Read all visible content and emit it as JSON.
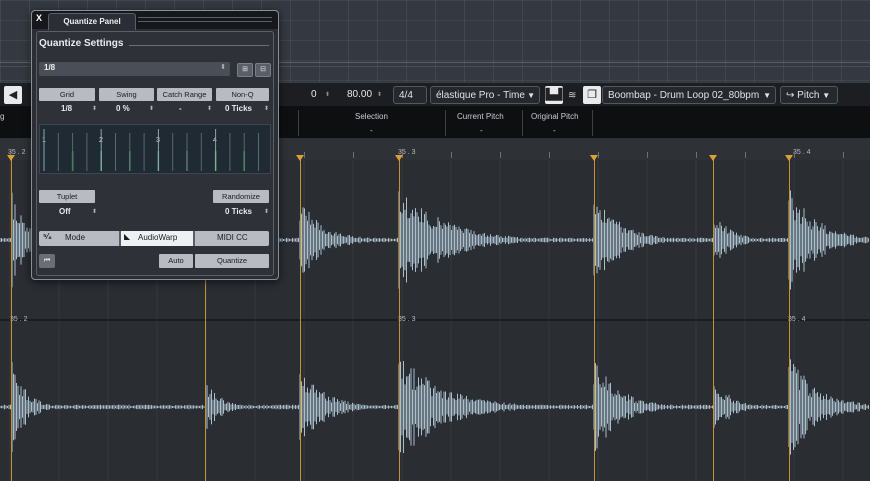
{
  "transport": {
    "value1": "0",
    "tempo": "80.00",
    "signature": "4/4",
    "algorithm": "élastique Pro - Time",
    "event_name": "Boombap - Drum Loop 02_80bpm",
    "pitch_label": "Pitch"
  },
  "infoline": {
    "left_fragment": "g",
    "selection_label": "Selection",
    "selection_value": "-",
    "current_pitch_label": "Current Pitch",
    "current_pitch_value": "-",
    "original_pitch_label": "Original Pitch",
    "original_pitch_value": "-"
  },
  "ruler": {
    "labels": [
      "35 . 2",
      "35 . 3",
      "35 . 4"
    ],
    "lane2_labels": [
      "35 . 2",
      "35 . 3",
      "35 . 4"
    ]
  },
  "quantize_panel": {
    "close_label": "X",
    "tab_label": "Quantize Panel",
    "section_title": "Quantize Settings",
    "preset": "1/8",
    "grid_label": "Grid",
    "grid_value": "1/8",
    "swing_label": "Swing",
    "swing_value": "0 %",
    "catch_label": "Catch Range",
    "catch_value": "-",
    "nonq_label": "Non-Q",
    "nonq_value": "0 Ticks",
    "beat_numbers": [
      "1",
      "2",
      "3",
      "4"
    ],
    "tuplet_label": "Tuplet",
    "tuplet_value": "Off",
    "randomize_label": "Randomize",
    "randomize_value": "0 Ticks",
    "mode_label": "Mode",
    "audiowarp_label": "AudioWarp",
    "midicc_label": "MIDI CC",
    "auto_label": "Auto",
    "quantize_label": "Quantize"
  },
  "colors": {
    "marker": "#e0a030",
    "waveform": "#a9c0cc",
    "panel_bg": "#2b2f35",
    "grid_accent": "#4fc36f"
  }
}
